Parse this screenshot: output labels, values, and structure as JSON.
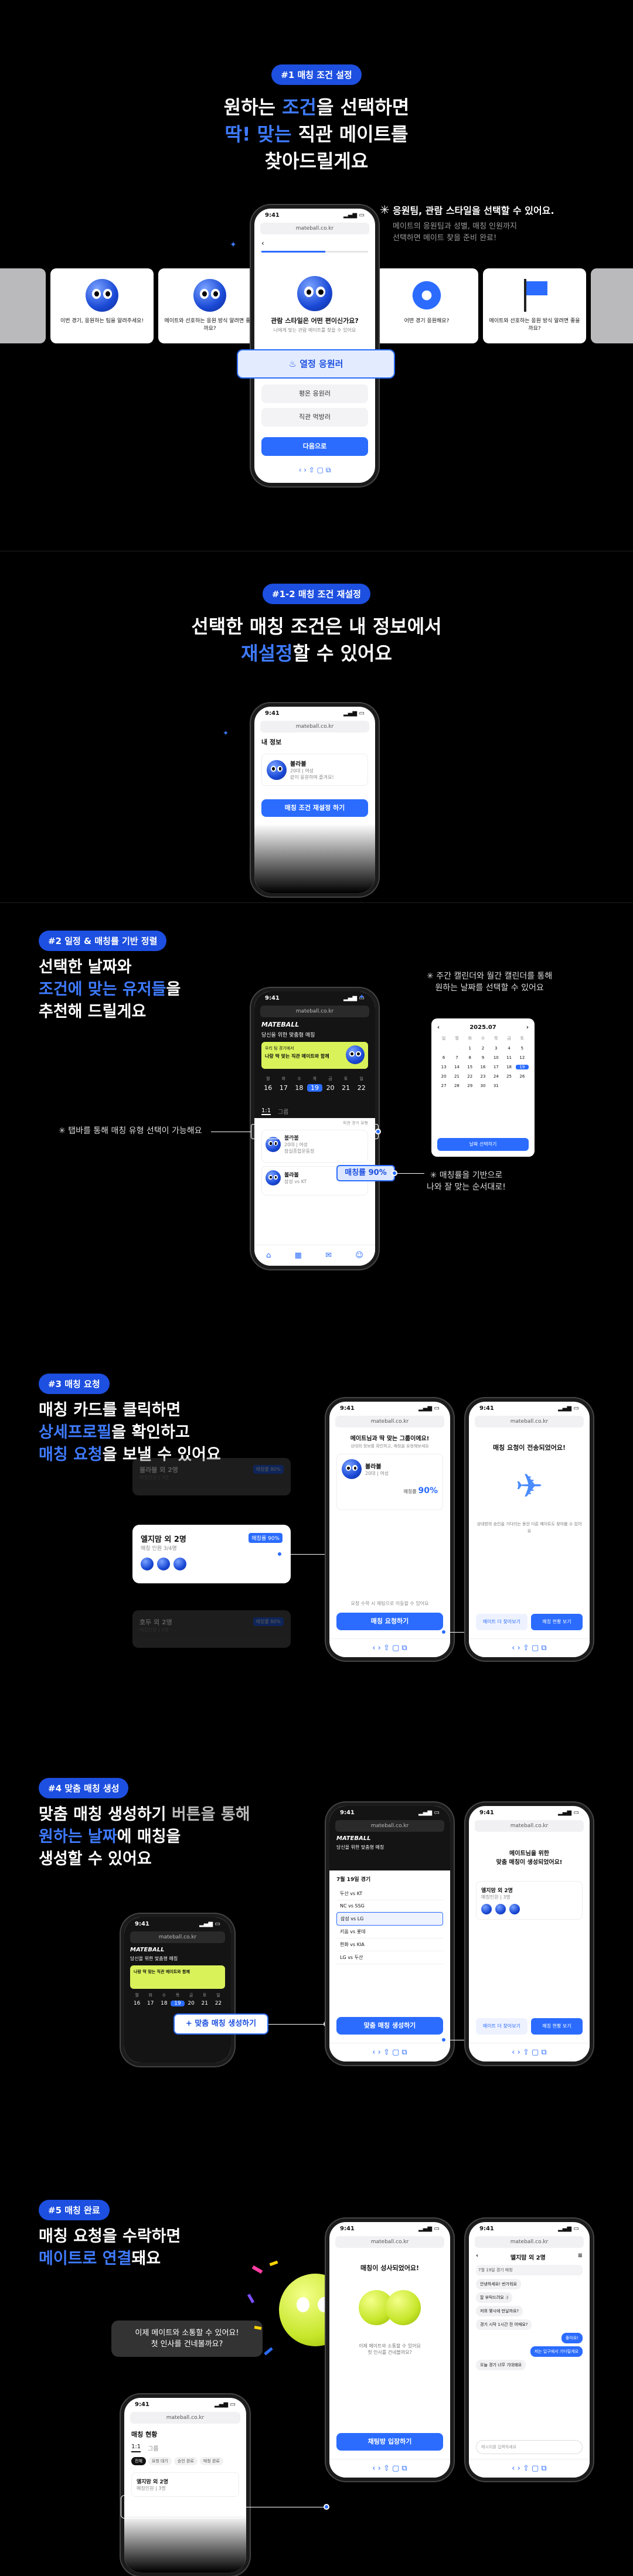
{
  "section1": {
    "pill": "#1 매칭 조건 설정",
    "title1": "원하는 ",
    "title_hl": "조건",
    "title2": "을 선택하면",
    "title3_hl": "딱! 맞는",
    "title3": " 직관 메이트를",
    "title4": "찾아드릴게요",
    "note_title": "응원팀, 관람 스타일을 선택할 수 있어요.",
    "note_body1": "메이트의 응원팀과 성별, 매칭 인원까지",
    "note_body2": "선택하면 메이트 찾을 준비 완료!",
    "cards": [
      "이번 경기, 응원하는 팀을 알려주세요!",
      "메이트와 선호하는 응원 방식 알려면 좋을까요?",
      "어떤 경기 응원해요?",
      "메이트와 선호하는 응원 방식 알려면 좋을까요?"
    ],
    "phone": {
      "time": "9:41",
      "url": "mateball.co.kr",
      "question": "관람 스타일은 어떤 편이신가요?",
      "sub": "나에게 맞는 관람 메이트를 찾을 수 있어요",
      "options": [
        "열정 응원러",
        "평온 응원러",
        "직관 먹방러"
      ],
      "cta": "다음으로"
    }
  },
  "section2": {
    "pill": "#1-2 매칭 조건 재설정",
    "title1": "선택한 매칭 조건은 내 정보에서",
    "title2_hl": "재설정",
    "title2": "할 수 있어요",
    "phone": {
      "time": "9:41",
      "url": "mateball.co.kr",
      "header": "내 정보",
      "name": "볼라볼",
      "meta": "20대 | 여성",
      "desc": "같이 응원하며 즐겨요!",
      "cta": "매칭 조건 재설정 하기"
    }
  },
  "section3": {
    "pill": "#2 일정 & 매칭률 기반 정렬",
    "title1": "선택한 날짜와",
    "title2_hl": "조건에 맞는 유저들",
    "title2": "을",
    "title3": "추천해 드릴게요",
    "note_cal1": "주간 캘린더와 월간 캘린더를 통해",
    "note_cal2": "원하는 날짜를 선택할 수 있어요",
    "note_tab": "탭바를 통해 매칭 유형 선택이 가능해요",
    "note_rate1": "매칭률을 기반으로",
    "note_rate2": "나와 잘 맞는 순서대로!",
    "phone": {
      "time": "9:41",
      "url": "mateball.co.kr",
      "logo": "MATEBALL",
      "greet": "당신을 위한 맞춤형 매칭",
      "banner_small": "우리 팀 경기에서",
      "banner": "나랑 딱 맞는 직관 메이트와 함께",
      "days": [
        "월",
        "화",
        "수",
        "목",
        "금",
        "토",
        "일"
      ],
      "dates": [
        "16",
        "17",
        "18",
        "19",
        "20",
        "21",
        "22"
      ],
      "tabs": [
        "1:1",
        "그룹"
      ],
      "filter": "직관 경기 유형",
      "rate": "매칭률 90%",
      "card_name": "볼라볼",
      "card_meta": "20대 | 여성",
      "card_team": "삼성 vs KT",
      "card_place": "잠실종합운동장"
    },
    "calendar": {
      "month": "2025.07",
      "weekdays": [
        "일",
        "월",
        "화",
        "수",
        "목",
        "금",
        "토"
      ],
      "cta": "날짜 선택하기"
    }
  },
  "section4": {
    "pill": "#3 매칭 요청",
    "title1": "매칭 카드",
    "title1b": "를 클릭하면",
    "title2_hl": "상세프로필",
    "title2": "을 확인하고",
    "title3_hl": "매칭 요청",
    "title3": "을 보낼 수 있어요",
    "cards": [
      {
        "name": "볼라볼 외 2명",
        "meta": "매칭인원 | 3명",
        "badge": "매칭률 80%"
      },
      {
        "name": "엘지맘 외 2명",
        "meta": "매칭 인원 3/4명",
        "badge": "매칭률 90%"
      },
      {
        "name": "호두 외 2명",
        "meta": "매칭인원 | 3명",
        "badge": "매칭률 80%"
      }
    ],
    "phoneA": {
      "time": "9:41",
      "url": "mateball.co.kr",
      "title": "메이트님과 딱 맞는 그룹이에요!",
      "sub": "상대의 정보를 확인하고, 매칭을 요청해보세요",
      "name": "볼라볼",
      "meta": "20대 | 여성",
      "rate": "90%",
      "info": "요청 수락 시 채팅으로 이동할 수 있어요",
      "cta": "매칭 요청하기"
    },
    "phoneB": {
      "time": "9:41",
      "url": "mateball.co.kr",
      "title": "매칭 요청이 전송되었어요!",
      "body": "상대방의 승인을 기다리는 동안 다른 메이트도 찾아볼 수 있어요",
      "btn1": "메이트 더 찾아보기",
      "btn2": "매칭 현황 보기"
    }
  },
  "section5": {
    "pill": "#4 맞춤 매칭 생성",
    "title1": "맞춤 매칭 생성하기",
    "title1b": " 버튼을 통해",
    "title2_hl": "원하는 날짜",
    "title2": "에 매칭을",
    "title3": "생성할 수 있어요",
    "create_btn": "맞춤 매칭 생성하기",
    "phoneA": {
      "time": "9:41",
      "url": "mateball.co.kr",
      "logo": "MATEBALL",
      "greet": "당신을 위한 맞춤형 매칭",
      "banner": "나랑 딱 맞는 직관 메이트와 함께"
    },
    "phoneB": {
      "time": "9:41",
      "url": "mateball.co.kr",
      "logo": "MATEBALL",
      "greet": "당신을 위한 맞춤형 매칭",
      "banner": "나랑 딱 맞는 직관 메이트와 함께",
      "list_title": "7월 19일 경기",
      "games": [
        "두산 vs KT",
        "NC vs SSG",
        "삼성 vs LG",
        "키움 vs 롯데",
        "한화 vs KIA",
        "LG vs 두산"
      ],
      "cta": "맞춤 매칭 생성하기"
    },
    "phoneC": {
      "time": "9:41",
      "url": "mateball.co.kr",
      "title1": "메이트님을 위한",
      "title2": "맞춤 매칭이 생성되었어요!",
      "card_title": "엘지맘 외 2명",
      "card_meta": "매칭인원 | 3명",
      "btn1": "메이트 더 찾아보기",
      "btn2": "매칭 현황 보기"
    }
  },
  "section6": {
    "pill": "#5 매칭 완료",
    "title1": "매칭 요청을 수락하면",
    "title2_hl": "메이트로 연결",
    "title2": "돼요",
    "bubble1": "이제 메이트와 소통할 수 있어요!",
    "bubble2": "첫 인사를 건네볼까요?",
    "phoneA": {
      "time": "9:41",
      "url": "mateball.co.kr",
      "header": "매칭 현황",
      "tabs": [
        "1:1",
        "그룹"
      ],
      "chips": [
        "전체",
        "요청 대기",
        "승인 완료",
        "매칭 완료"
      ],
      "card": "엘지맘 외 2명",
      "meta": "매칭인원 | 3명"
    },
    "phoneB": {
      "time": "9:41",
      "url": "mateball.co.kr",
      "title": "매칭이 성사되었어요!",
      "body1": "이제 메이트와 소통할 수 있어요",
      "body2": "첫 인사를 건네볼까요?",
      "cta": "채팅방 입장하기"
    },
    "phoneC": {
      "time": "9:41",
      "url": "mateball.co.kr",
      "header": "엘지맘 외 2명",
      "notice": "7월 19일 경기 매칭",
      "msgs": [
        "안녕하세요! 반가워요",
        "잘 부탁드려요 :)",
        "저희 몇시에 만날까요?",
        "경기 시작 1시간 전 어때요?",
        "좋아요!",
        "저는 입구에서 기다릴게요",
        "오늘 경기 너무 기대돼요"
      ],
      "input": "메시지를 입력하세요"
    }
  }
}
